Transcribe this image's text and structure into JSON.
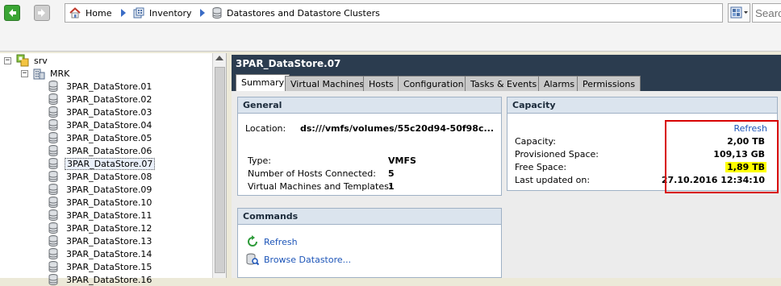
{
  "breadcrumb": {
    "home": "Home",
    "inventory": "Inventory",
    "datastores": "Datastores and Datastore Clusters"
  },
  "search": {
    "placeholder": "Search"
  },
  "tree": {
    "root": "srv",
    "datacenter": "MRK",
    "datastores": [
      "3PAR_DataStore.01",
      "3PAR_DataStore.02",
      "3PAR_DataStore.03",
      "3PAR_DataStore.04",
      "3PAR_DataStore.05",
      "3PAR_DataStore.06",
      "3PAR_DataStore.07",
      "3PAR_DataStore.08",
      "3PAR_DataStore.09",
      "3PAR_DataStore.10",
      "3PAR_DataStore.11",
      "3PAR_DataStore.12",
      "3PAR_DataStore.13",
      "3PAR_DataStore.14",
      "3PAR_DataStore.15",
      "3PAR_DataStore.16"
    ],
    "selected_index": 6
  },
  "object_title": "3PAR_DataStore.07",
  "tabs": [
    "Summary",
    "Virtual Machines",
    "Hosts",
    "Configuration",
    "Tasks & Events",
    "Alarms",
    "Permissions"
  ],
  "active_tab": "Summary",
  "general": {
    "title": "General",
    "location_label": "Location:",
    "location_value": "ds:///vmfs/volumes/55c20d94-50f98c...",
    "type_label": "Type:",
    "type_value": "VMFS",
    "hosts_label": "Number of Hosts Connected:",
    "hosts_value": "5",
    "vms_label": "Virtual Machines and Templates:",
    "vms_value": "1"
  },
  "commands": {
    "title": "Commands",
    "refresh": "Refresh",
    "browse": "Browse Datastore..."
  },
  "capacity": {
    "title": "Capacity",
    "refresh": "Refresh",
    "capacity_label": "Capacity:",
    "capacity_value": "2,00 TB",
    "provisioned_label": "Provisioned Space:",
    "provisioned_value": "109,13 GB",
    "free_label": "Free Space:",
    "free_value": "1,89 TB",
    "updated_label": "Last updated on:",
    "updated_value": "27.10.2016 12:34:10"
  },
  "colors": {
    "title_bar": "#2b3c4f",
    "highlight_box": "#d80000",
    "highlight_fill": "#ffff00",
    "link": "#1d55b8"
  }
}
